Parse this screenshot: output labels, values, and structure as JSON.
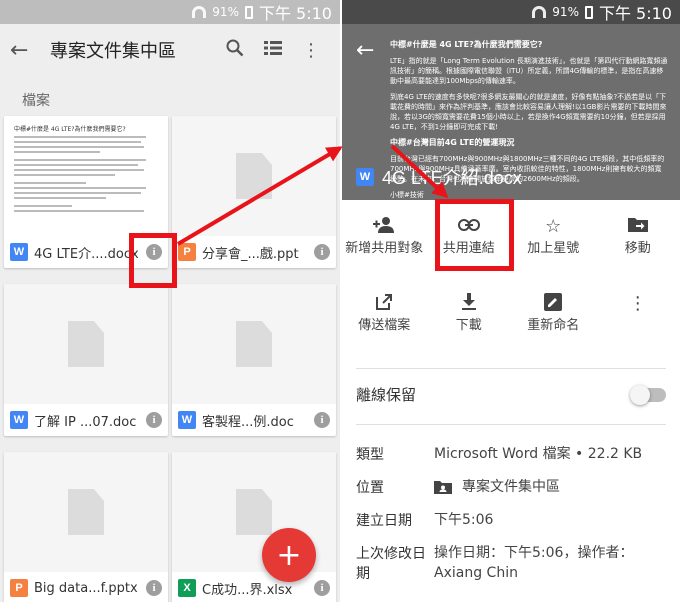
{
  "left": {
    "status": {
      "battery": "91%",
      "time": "下午 5:10"
    },
    "appbar": {
      "title": "專案文件集中區"
    },
    "section": "檔案",
    "files": [
      {
        "name": "4G LTE介....docx",
        "type": "W",
        "color": "#4285f4"
      },
      {
        "name": "分享會_...戲.ppt",
        "type": "P",
        "color": "#f4813f"
      },
      {
        "name": "了解 IP ...07.doc",
        "type": "W",
        "color": "#4285f4"
      },
      {
        "name": "客製程...例.doc",
        "type": "W",
        "color": "#4285f4"
      },
      {
        "name": "Big data...f.pptx",
        "type": "P",
        "color": "#f4813f"
      },
      {
        "name": "C成功...界.xlsx",
        "type": "X",
        "color": "#0f9d58"
      }
    ],
    "fab": "+",
    "doc_preview": {
      "title": "中標#什麼是 4G LTE?為什麼我們需要它?"
    }
  },
  "right": {
    "status": {
      "battery": "91%",
      "time": "下午 5:10"
    },
    "preview": {
      "file_name": "4G LTE介紹.docx",
      "file_type": "W",
      "p1": "中標#什麼是 4G LTE?為什麼我們需要它?",
      "p2": "LTE」指的就是「Long Term Evolution 長期演進技術」，也就是「第四代行動網路寬頻通訊技術」的簡稱。根據國際電信聯盟（ITU）所定義，所謂4G傳輸的標準，是指在高速移動中最高要能達到100Mbps的傳輸速率。",
      "p3": "到底4G LTE的速度有多快呢?很多網友最關心的就是速度，好像有點抽象?不過若是以「下載花費的時間」來作為評判基準，應該會比較容易讓人理解!以1GB影片需要的下載時間來說，若以3G的頻寬需要花費15個小時以上，若是換作4G頻寬需要約10分鐘，但若是採用4G LTE，不到1分鐘即可完成下載!",
      "p4": "中標#台灣目前4G LTE的營運現況",
      "p5": "目前台灣已經有700MHz與900MHz與1800MHz三種不同的4G LTE頻段，其中低頻率的700MHz與900MHz具備涵蓋率廣。室內收訊較佳的特性，1800MHz則擁有較大的頻寬優勢。在未來，台灣也將會開放頻率更高的2600MHz的頻段。",
      "p6": "小標#技術"
    },
    "actions": [
      {
        "icon": "add-person-icon",
        "label": "新增共用對象"
      },
      {
        "icon": "link-icon",
        "label": "共用連結"
      },
      {
        "icon": "star-icon",
        "label": "加上星號"
      },
      {
        "icon": "move-icon",
        "label": "移動"
      },
      {
        "icon": "send-icon",
        "label": "傳送檔案"
      },
      {
        "icon": "download-icon",
        "label": "下載"
      },
      {
        "icon": "rename-icon",
        "label": "重新命名"
      }
    ],
    "offline_label": "離線保留",
    "details": {
      "type_key": "類型",
      "type_val": "Microsoft Word 檔案 • 22.2 KB",
      "location_key": "位置",
      "location_val": "專案文件集中區",
      "created_key": "建立日期",
      "created_val": "下午5:06",
      "modified_key": "上次修改日期",
      "modified_val": "操作日期：下午5:06，操作者：Axiang Chin"
    }
  },
  "colors": {
    "highlight": "#e8141a",
    "fab": "#e53935"
  }
}
